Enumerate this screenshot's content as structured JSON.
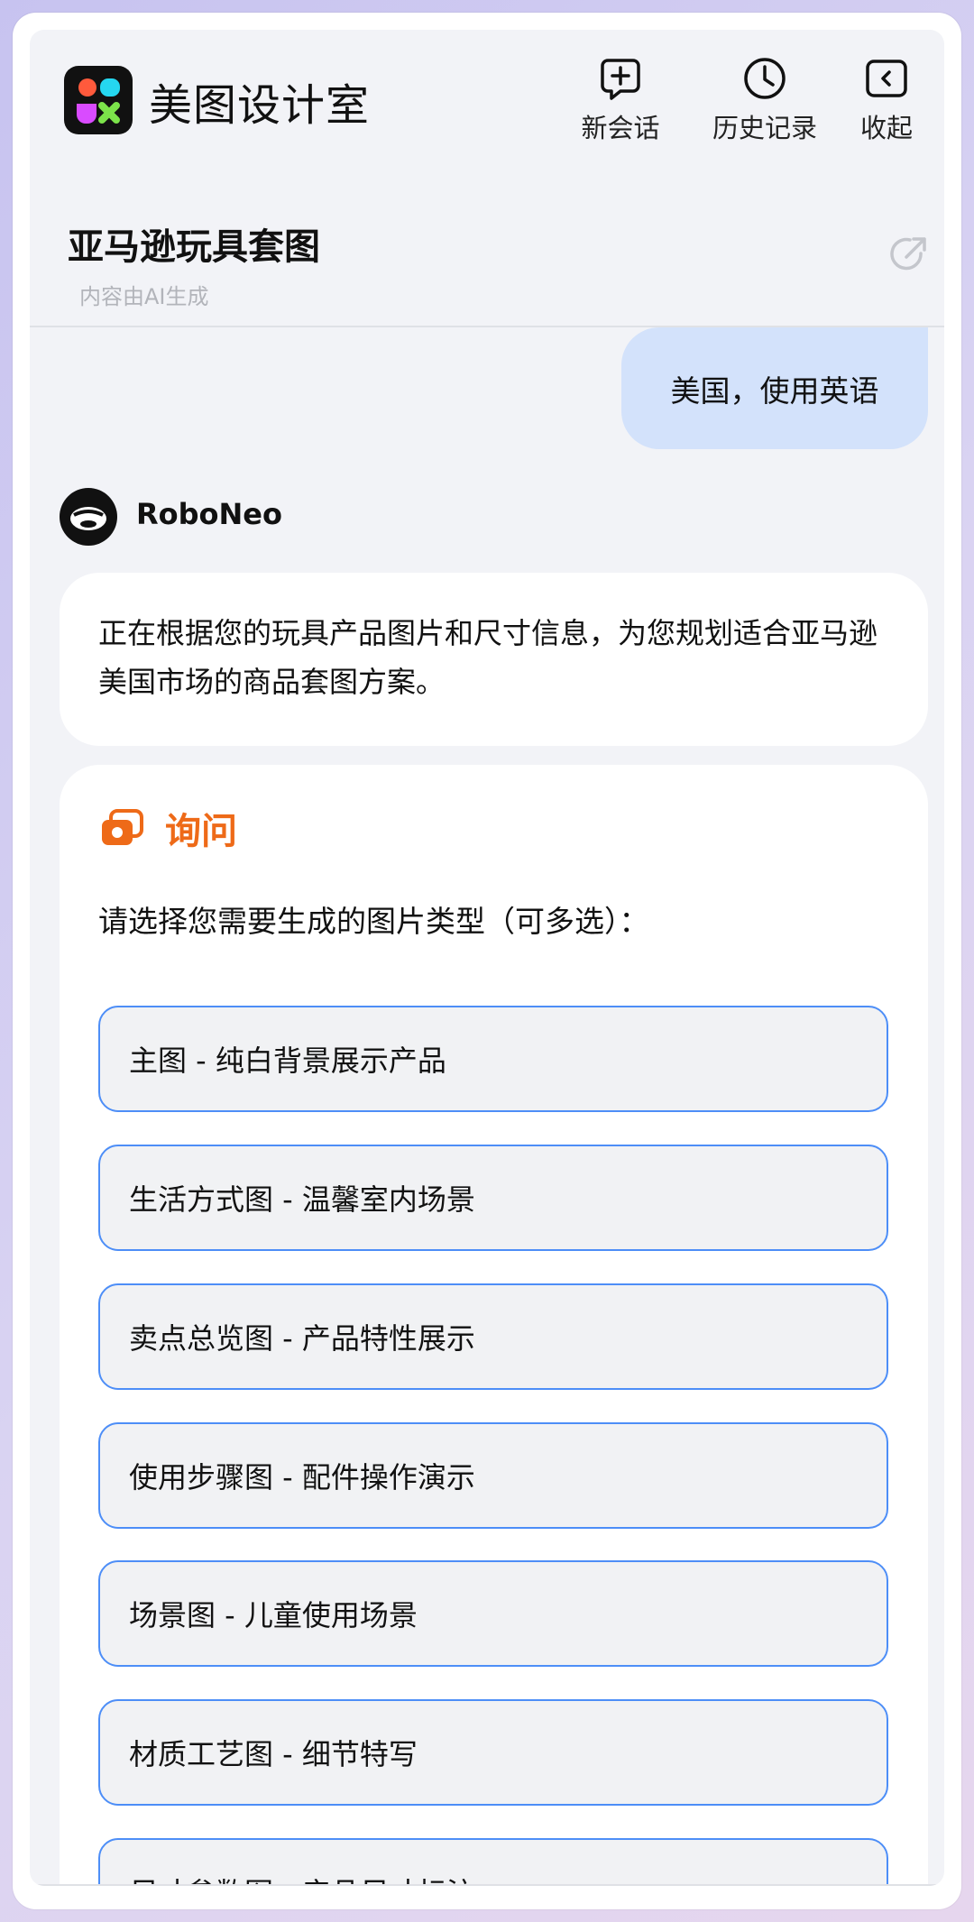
{
  "app": {
    "brand": "美图设计室",
    "actions": {
      "new_chat": "新会话",
      "history": "历史记录",
      "collapse": "收起"
    }
  },
  "conversation": {
    "title": "亚马逊玩具套图",
    "ai_note": "内容由AI生成"
  },
  "messages": {
    "user": "美国，使用英语",
    "bot_name": "RoboNeo",
    "bot_text": "正在根据您的玩具产品图片和尺寸信息，为您规划适合亚马逊美国市场的商品套图方案。"
  },
  "ask": {
    "title": "询问",
    "question": "请选择您需要生成的图片类型（可多选）：",
    "options": [
      "主图 - 纯白背景展示产品",
      "生活方式图 - 温馨室内场景",
      "卖点总览图 - 产品特性展示",
      "使用步骤图 - 配件操作演示",
      "场景图 - 儿童使用场景",
      "材质工艺图 - 细节特写",
      "尺寸参数图 - 产品尺寸标注"
    ]
  },
  "colors": {
    "accent_orange": "#ee6a18",
    "option_border": "#4d8ef7",
    "user_bubble": "#d3e2fb",
    "panel_bg": "#f2f3f7"
  }
}
